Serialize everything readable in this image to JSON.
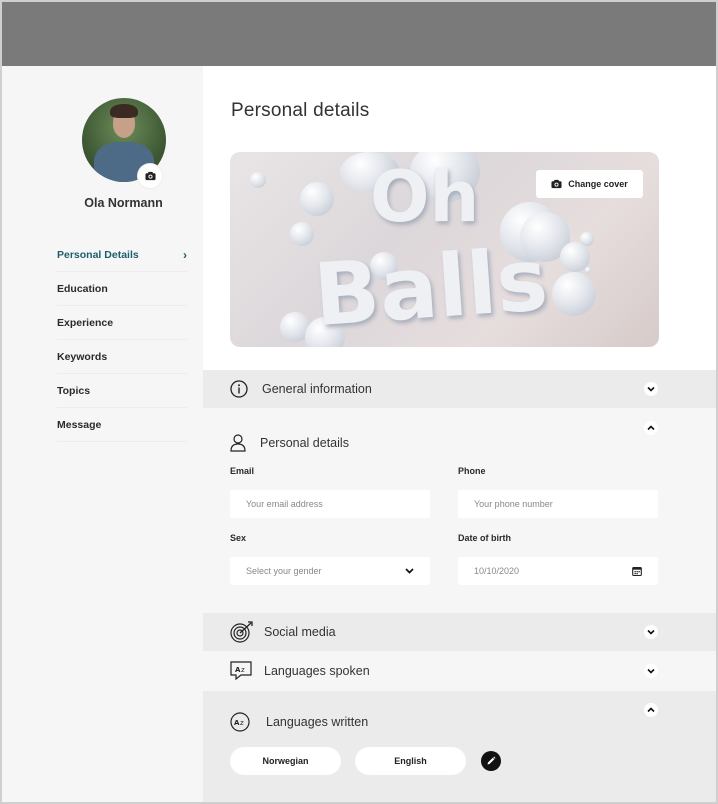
{
  "user": {
    "name": "Ola Normann"
  },
  "sidebar": {
    "items": [
      {
        "label": "Personal Details",
        "active": true
      },
      {
        "label": "Education"
      },
      {
        "label": "Experience"
      },
      {
        "label": "Keywords"
      },
      {
        "label": "Topics"
      },
      {
        "label": "Message"
      }
    ]
  },
  "main": {
    "title": "Personal details",
    "cover": {
      "change_label": "Change cover",
      "art_line1": "Oh",
      "art_line2": "Balls"
    },
    "sections": {
      "general": {
        "title": "General information"
      },
      "personal": {
        "title": "Personal details",
        "email_label": "Email",
        "email_placeholder": "Your email address",
        "phone_label": "Phone",
        "phone_placeholder": "Your phone number",
        "sex_label": "Sex",
        "sex_placeholder": "Select your gender",
        "dob_label": "Date of birth",
        "dob_value": "10/10/2020"
      },
      "social": {
        "title": "Social media"
      },
      "spoken": {
        "title": "Languages spoken"
      },
      "written": {
        "title": "Languages written",
        "languages": [
          "Norwegian",
          "English"
        ]
      }
    }
  },
  "colors": {
    "accent": "#1e5d6b",
    "topbar": "#7a7a7a",
    "section_bg": "#ebebeb",
    "panel_bg": "#f6f6f6"
  },
  "icons": [
    "camera-icon",
    "chevron-right-icon",
    "info-icon",
    "user-icon",
    "chevron-down-icon",
    "chevron-up-icon",
    "calendar-icon",
    "target-icon",
    "translate-icon",
    "pencil-icon"
  ]
}
